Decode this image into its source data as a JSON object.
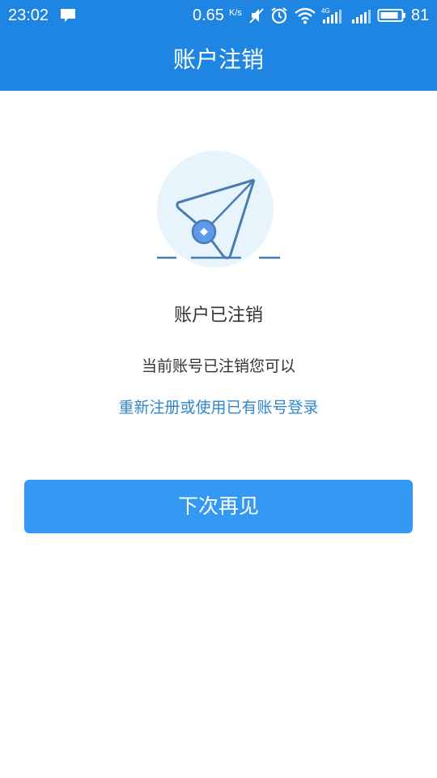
{
  "status_bar": {
    "time": "23:02",
    "net_speed": "0.65",
    "net_speed_unit": "K/s",
    "network_type": "4G",
    "battery_level": "81",
    "icons": [
      "message-icon",
      "mute-icon",
      "alarm-icon",
      "wifi-icon",
      "signal-icon",
      "battery-icon"
    ]
  },
  "header": {
    "title": "账户注销"
  },
  "main": {
    "illustration_icon": "paper-plane-icon",
    "status_title": "账户已注销",
    "description": "当前账号已注销您可以",
    "link_text": "重新注册或使用已有账号登录",
    "button_label": "下次再见"
  },
  "colors": {
    "header": "#1e86e2",
    "button": "#3399f3",
    "link": "#2f86c8",
    "text": "#333333"
  }
}
